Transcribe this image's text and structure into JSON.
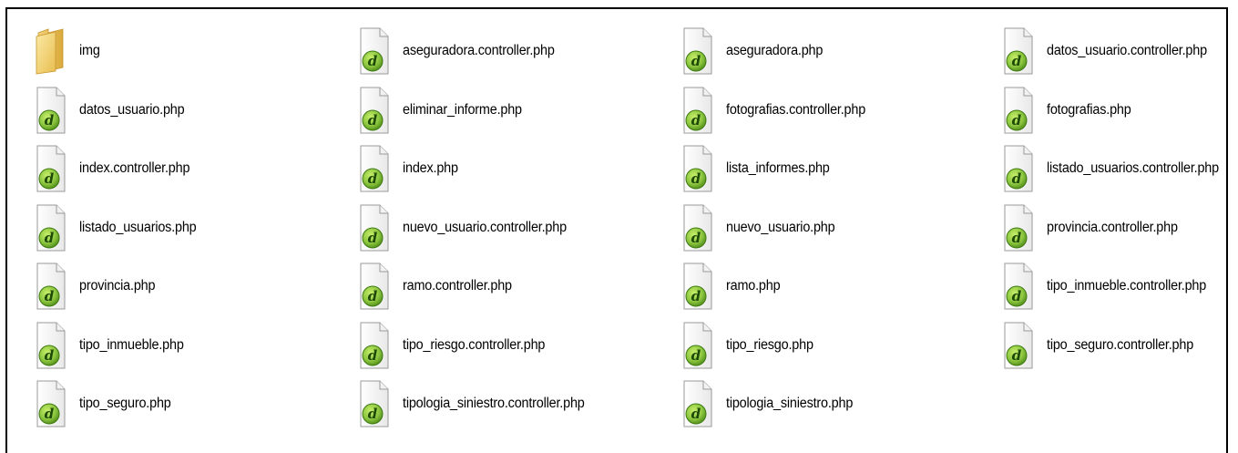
{
  "files": [
    {
      "label": "img",
      "icon": "folder-icon"
    },
    {
      "label": "aseguradora.controller.php",
      "icon": "dreamweaver-php-icon"
    },
    {
      "label": "aseguradora.php",
      "icon": "dreamweaver-php-icon"
    },
    {
      "label": "datos_usuario.controller.php",
      "icon": "dreamweaver-php-icon"
    },
    {
      "label": "datos_usuario.php",
      "icon": "dreamweaver-php-icon"
    },
    {
      "label": "eliminar_informe.php",
      "icon": "dreamweaver-php-icon"
    },
    {
      "label": "fotografias.controller.php",
      "icon": "dreamweaver-php-icon"
    },
    {
      "label": "fotografias.php",
      "icon": "dreamweaver-php-icon"
    },
    {
      "label": "index.controller.php",
      "icon": "dreamweaver-php-icon"
    },
    {
      "label": "index.php",
      "icon": "dreamweaver-php-icon"
    },
    {
      "label": "lista_informes.php",
      "icon": "dreamweaver-php-icon"
    },
    {
      "label": "listado_usuarios.controller.php",
      "icon": "dreamweaver-php-icon"
    },
    {
      "label": "listado_usuarios.php",
      "icon": "dreamweaver-php-icon"
    },
    {
      "label": "nuevo_usuario.controller.php",
      "icon": "dreamweaver-php-icon"
    },
    {
      "label": "nuevo_usuario.php",
      "icon": "dreamweaver-php-icon"
    },
    {
      "label": "provincia.controller.php",
      "icon": "dreamweaver-php-icon"
    },
    {
      "label": "provincia.php",
      "icon": "dreamweaver-php-icon"
    },
    {
      "label": "ramo.controller.php",
      "icon": "dreamweaver-php-icon"
    },
    {
      "label": "ramo.php",
      "icon": "dreamweaver-php-icon"
    },
    {
      "label": "tipo_inmueble.controller.php",
      "icon": "dreamweaver-php-icon"
    },
    {
      "label": "tipo_inmueble.php",
      "icon": "dreamweaver-php-icon"
    },
    {
      "label": "tipo_riesgo.controller.php",
      "icon": "dreamweaver-php-icon"
    },
    {
      "label": "tipo_riesgo.php",
      "icon": "dreamweaver-php-icon"
    },
    {
      "label": "tipo_seguro.controller.php",
      "icon": "dreamweaver-php-icon"
    },
    {
      "label": "tipo_seguro.php",
      "icon": "dreamweaver-php-icon"
    },
    {
      "label": "tipologia_siniestro.controller.php",
      "icon": "dreamweaver-php-icon"
    },
    {
      "label": "tipologia_siniestro.php",
      "icon": "dreamweaver-php-icon"
    }
  ],
  "colors": {
    "folder_light": "#f8e08a",
    "folder_dark": "#d9a93a",
    "badge_green": "#8cc63f",
    "badge_dark_green": "#3d7a12"
  }
}
